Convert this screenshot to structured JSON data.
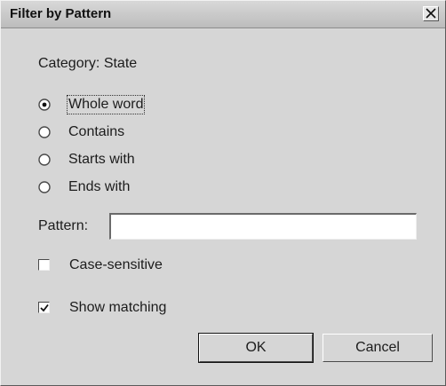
{
  "window": {
    "title": "Filter by Pattern"
  },
  "category": {
    "label": "Category: State"
  },
  "match_mode": {
    "options": [
      {
        "label": "Whole word",
        "selected": true
      },
      {
        "label": "Contains",
        "selected": false
      },
      {
        "label": "Starts with",
        "selected": false
      },
      {
        "label": "Ends with",
        "selected": false
      }
    ]
  },
  "pattern": {
    "label": "Pattern:",
    "value": ""
  },
  "options": {
    "case_sensitive": {
      "label": "Case-sensitive",
      "checked": false
    },
    "show_matching": {
      "label": "Show matching",
      "checked": true
    }
  },
  "buttons": {
    "ok": "OK",
    "cancel": "Cancel"
  }
}
